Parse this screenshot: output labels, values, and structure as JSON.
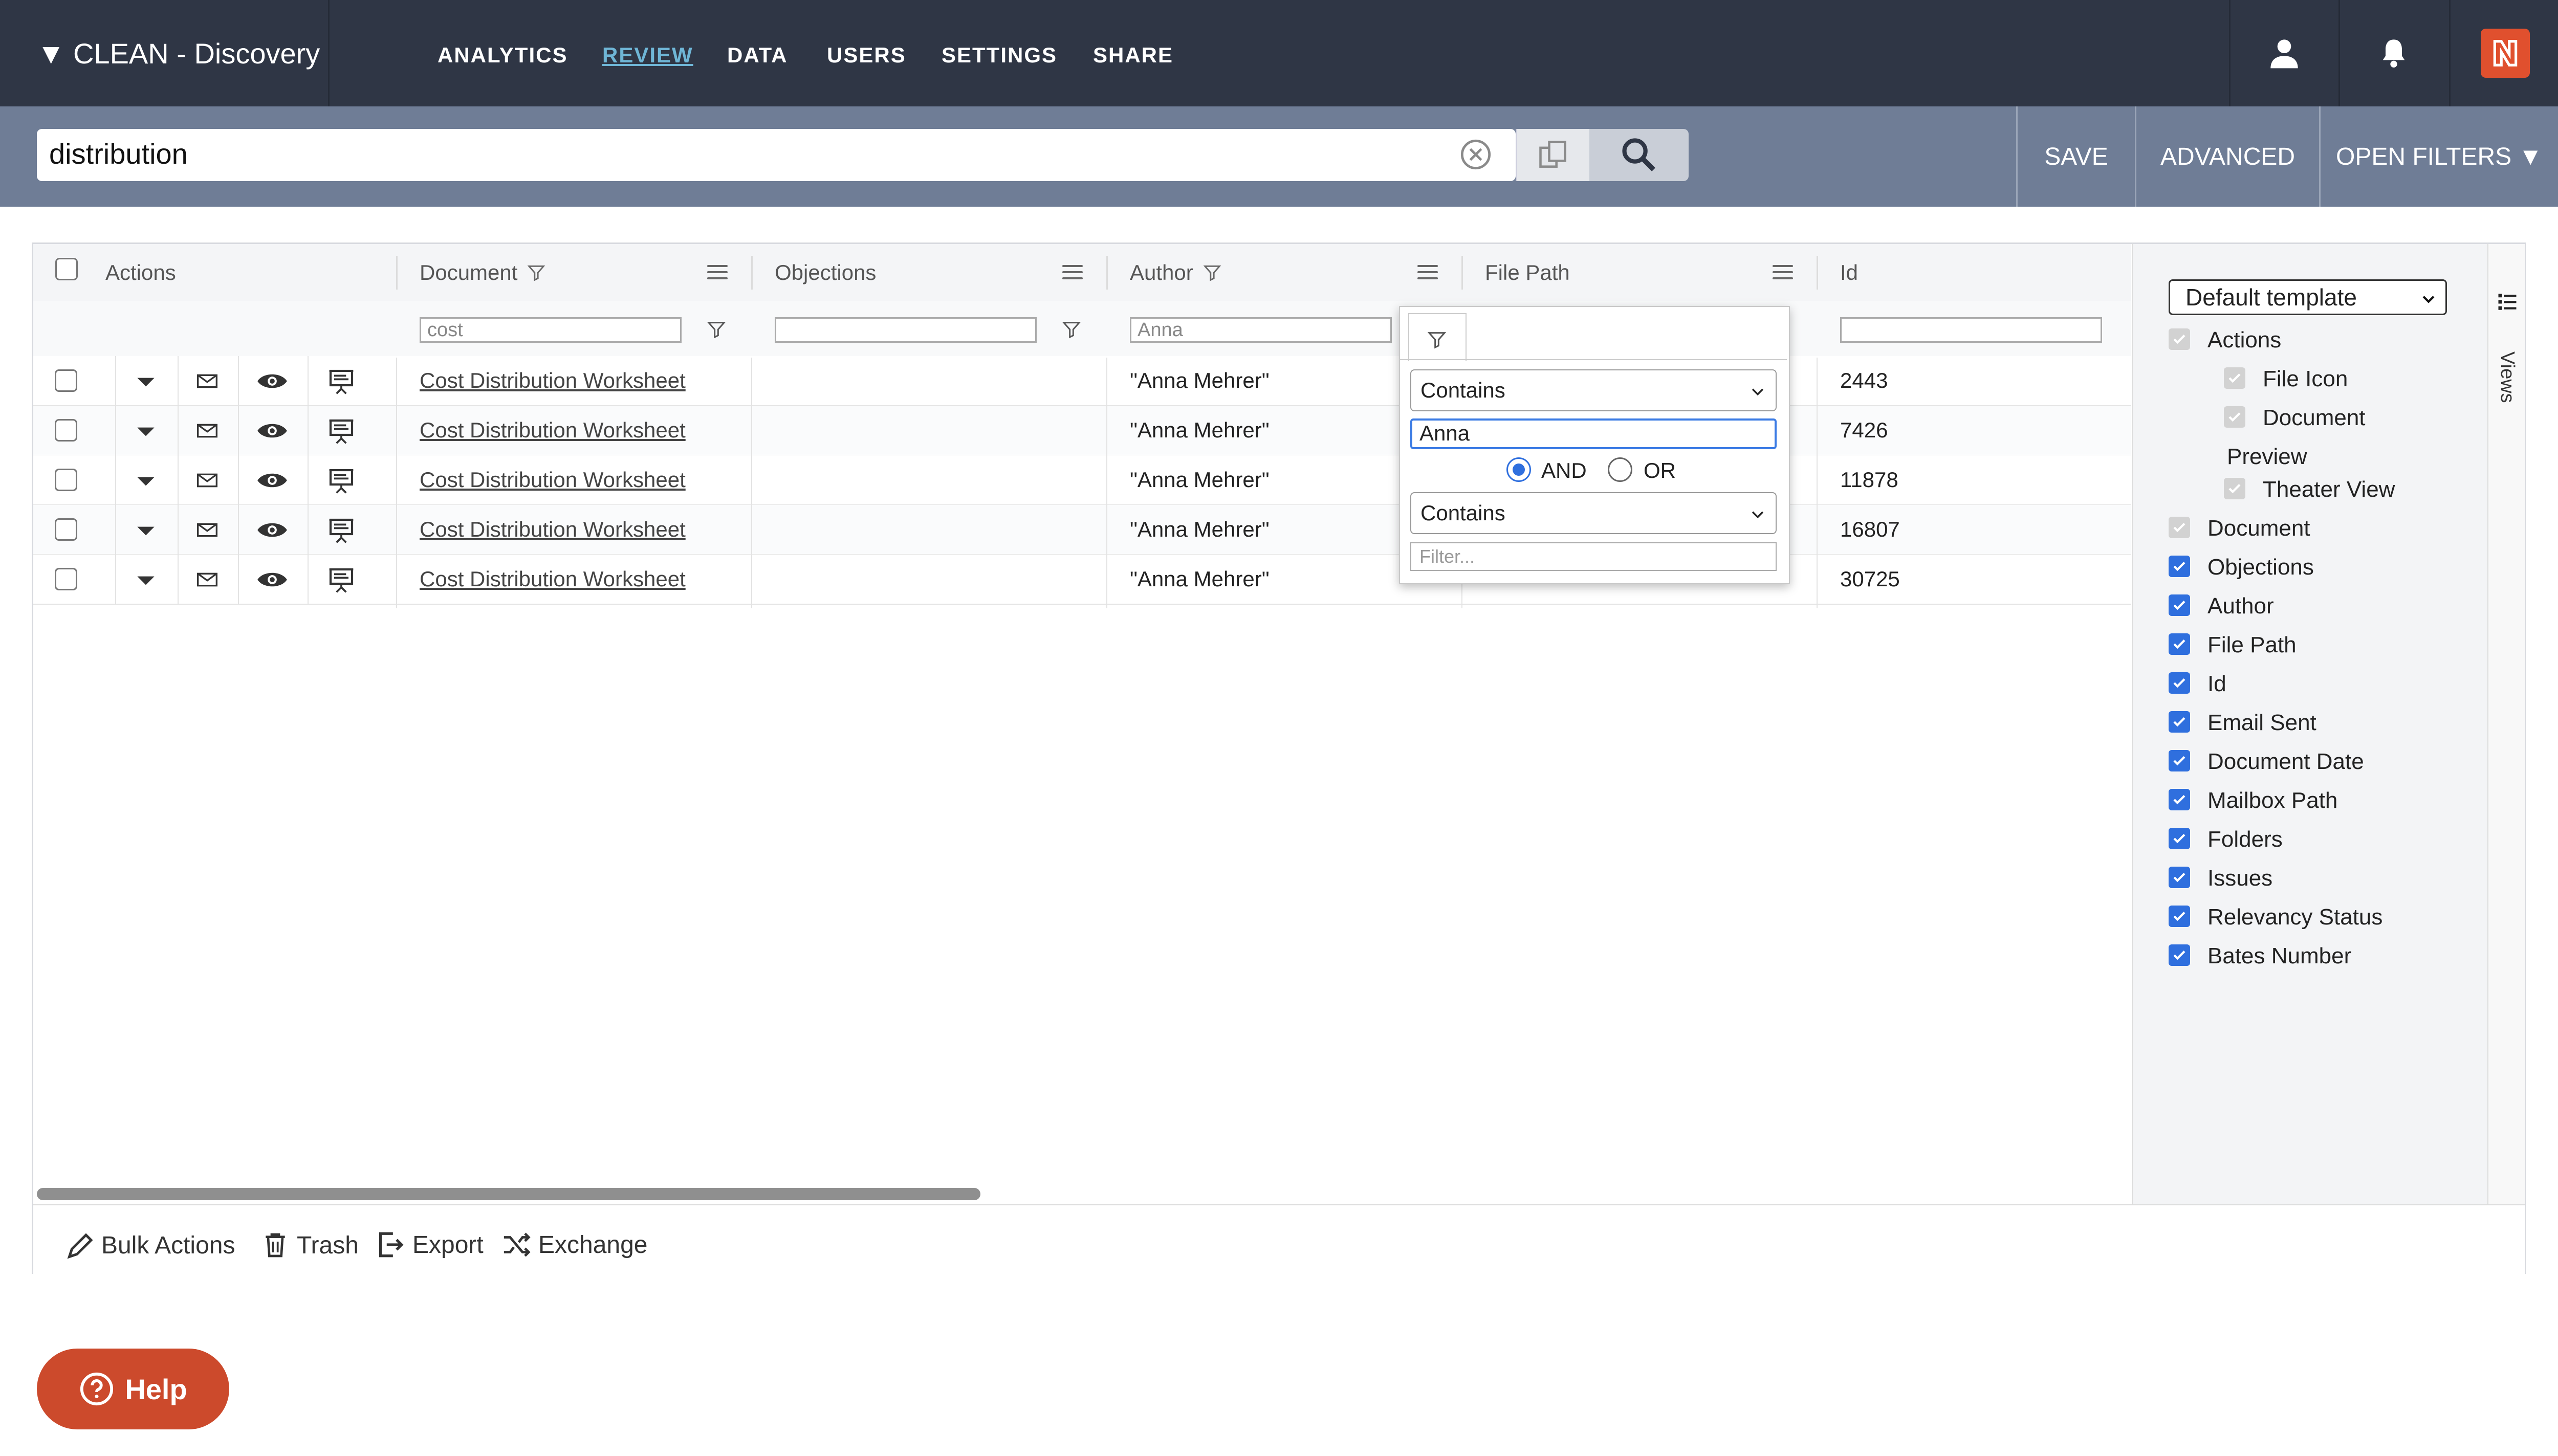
{
  "app": {
    "title": "▼ CLEAN - Discovery",
    "logo_icon": "n-logo-icon"
  },
  "nav": [
    {
      "label": "ANALYTICS"
    },
    {
      "label": "REVIEW",
      "active": true
    },
    {
      "label": "DATA"
    },
    {
      "label": "USERS"
    },
    {
      "label": "SETTINGS"
    },
    {
      "label": "SHARE"
    }
  ],
  "search": {
    "value": "distribution",
    "save_label": "SAVE",
    "advanced_label": "ADVANCED",
    "open_filters_label": "OPEN FILTERS ▼"
  },
  "columns": {
    "actions": "Actions",
    "document": "Document",
    "objections": "Objections",
    "author": "Author",
    "file_path": "File Path",
    "id": "Id"
  },
  "filters": {
    "document": "cost",
    "objections": "",
    "author": "Anna",
    "id": ""
  },
  "rows": [
    {
      "document": "Cost Distribution Worksheet",
      "author": "\"Anna Mehrer\"",
      "id": "2443"
    },
    {
      "document": "Cost Distribution Worksheet",
      "author": "\"Anna Mehrer\"",
      "id": "7426"
    },
    {
      "document": "Cost Distribution Worksheet",
      "author": "\"Anna Mehrer\"",
      "id": "11878"
    },
    {
      "document": "Cost Distribution Worksheet",
      "author": "\"Anna Mehrer\"",
      "id": "16807"
    },
    {
      "document": "Cost Distribution Worksheet",
      "author": "\"Anna Mehrer\"",
      "id": "30725"
    }
  ],
  "popup": {
    "condition1": "Contains",
    "value1": "Anna",
    "and_label": "AND",
    "or_label": "OR",
    "selected_operator": "AND",
    "condition2": "Contains",
    "placeholder2": "Filter..."
  },
  "panel": {
    "template": "Default template",
    "views_label": "Views",
    "items": [
      {
        "label": "Actions",
        "state": "disabled",
        "indent": 0
      },
      {
        "label": "File Icon",
        "state": "disabled",
        "indent": 1
      },
      {
        "label": "Document",
        "label2": "Preview",
        "state": "disabled",
        "indent": 1
      },
      {
        "label": "Theater View",
        "state": "disabled",
        "indent": 1
      },
      {
        "label": "Document",
        "state": "disabled",
        "indent": 0
      },
      {
        "label": "Objections",
        "state": "checked",
        "indent": 0
      },
      {
        "label": "Author",
        "state": "checked",
        "indent": 0
      },
      {
        "label": "File Path",
        "state": "checked",
        "indent": 0
      },
      {
        "label": "Id",
        "state": "checked",
        "indent": 0
      },
      {
        "label": "Email Sent",
        "state": "checked",
        "indent": 0
      },
      {
        "label": "Document Date",
        "state": "checked",
        "indent": 0
      },
      {
        "label": "Mailbox Path",
        "state": "checked",
        "indent": 0
      },
      {
        "label": "Folders",
        "state": "checked",
        "indent": 0
      },
      {
        "label": "Issues",
        "state": "checked",
        "indent": 0
      },
      {
        "label": "Relevancy Status",
        "state": "checked",
        "indent": 0
      },
      {
        "label": "Bates Number",
        "state": "checked",
        "indent": 0
      }
    ]
  },
  "bottom": {
    "bulk": "Bulk Actions",
    "trash": "Trash",
    "export": "Export",
    "exchange": "Exchange"
  },
  "help": {
    "label": "Help"
  },
  "colors": {
    "nav_bg": "#2f3645",
    "band_bg": "#6f7d96",
    "accent": "#2f6fde",
    "help_bg": "#cc4a2c",
    "active_link": "#6fb6d6"
  }
}
